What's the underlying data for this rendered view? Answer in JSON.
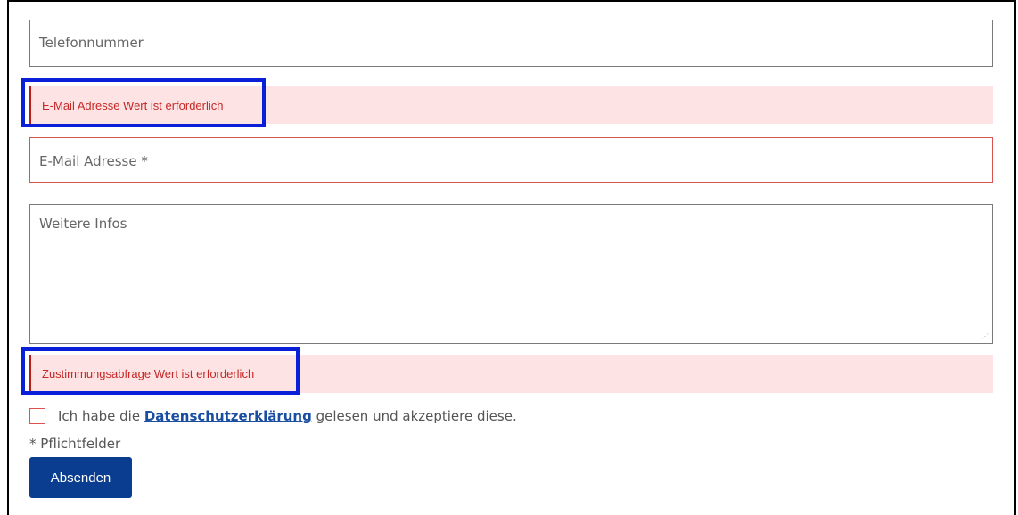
{
  "form": {
    "phone": {
      "placeholder": "Telefonnummer"
    },
    "email_error": "E-Mail Adresse Wert ist erforderlich",
    "email": {
      "placeholder": "E-Mail Adresse *"
    },
    "info": {
      "placeholder": "Weitere Infos"
    },
    "consent_error": "Zustimmungsabfrage Wert ist erforderlich",
    "consent": {
      "prefix": "Ich habe die ",
      "link": "Datenschutzerklärung",
      "suffix": " gelesen und akzeptiere diese."
    },
    "required_note": "* Pflichtfelder",
    "submit_label": "Absenden"
  },
  "colors": {
    "error_text": "#c62828",
    "error_bg": "#fde3e3",
    "highlight": "#0a1fd8",
    "button": "#0a3d8f"
  }
}
